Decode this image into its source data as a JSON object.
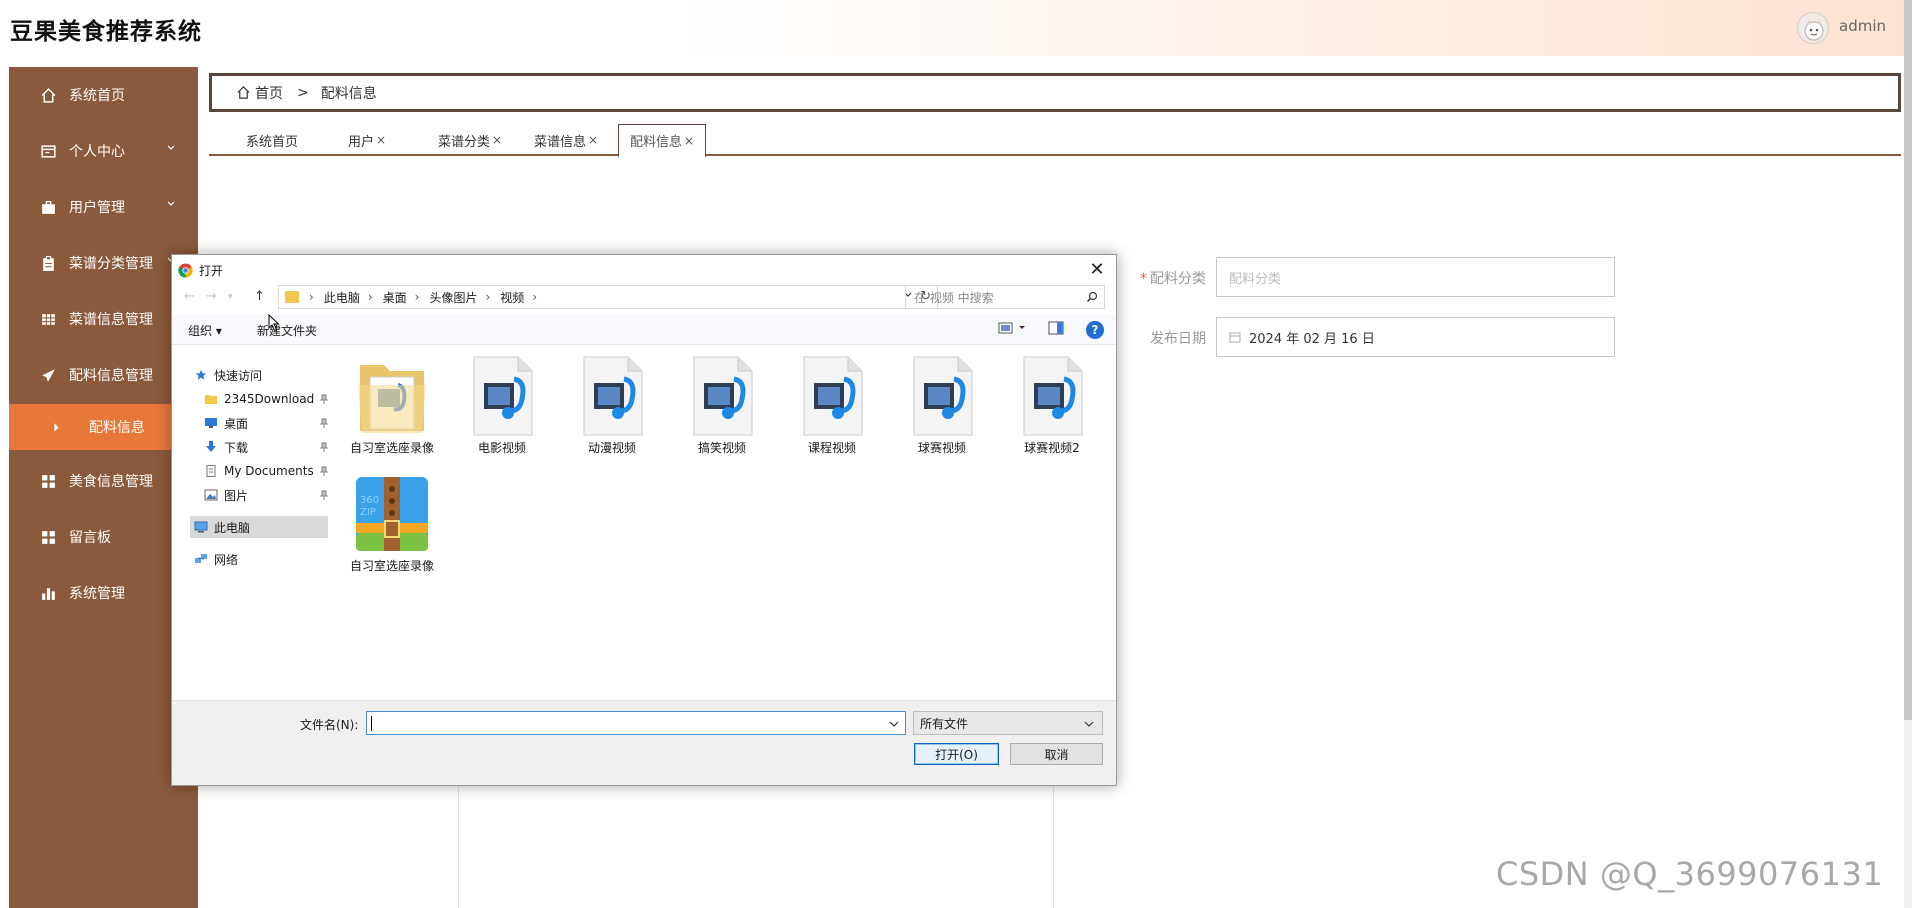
{
  "app": {
    "title": "豆果美食推荐系统",
    "username": "admin"
  },
  "sidebar": {
    "items": [
      {
        "label": "系统首页",
        "icon": "home-icon"
      },
      {
        "label": "个人中心",
        "icon": "card-icon"
      },
      {
        "label": "用户管理",
        "icon": "briefcase-icon"
      },
      {
        "label": "菜谱分类管理",
        "icon": "clipboard-icon"
      },
      {
        "label": "菜谱信息管理",
        "icon": "grid-icon"
      },
      {
        "label": "配料信息管理",
        "icon": "paper-plane-icon"
      },
      {
        "label": "配料信息",
        "icon": "caret-right-icon"
      },
      {
        "label": "美食信息管理",
        "icon": "apps-icon"
      },
      {
        "label": "留言板",
        "icon": "apps-icon"
      },
      {
        "label": "系统管理",
        "icon": "bar-chart-icon"
      }
    ],
    "active_color": "#e8773a",
    "bg_color": "#8b5a3c"
  },
  "breadcrumb": {
    "home": "首页",
    "separator": ">",
    "current": "配料信息"
  },
  "tabs": [
    {
      "label": "系统首页",
      "close": ""
    },
    {
      "label": "用户",
      "close": "×"
    },
    {
      "label": "菜谱分类",
      "close": "×"
    },
    {
      "label": "菜谱信息",
      "close": "×"
    },
    {
      "label": "配料信息",
      "close": "×"
    }
  ],
  "form": {
    "category_label": "配料分类",
    "category_required": "*",
    "category_placeholder": "配料分类",
    "date_label": "发布日期",
    "date_value": "2024 年 02 月 16 日"
  },
  "dialog": {
    "title": "打开",
    "close": "✕",
    "path": [
      "此电脑",
      "桌面",
      "头像图片",
      "视频"
    ],
    "search_placeholder": "在 视频 中搜索",
    "organize": "组织 ▾",
    "new_folder": "新建文件夹",
    "help": "?",
    "nav_pane": [
      {
        "label": "快速访问",
        "icon": "star-icon"
      },
      {
        "label": "2345Download",
        "icon": "folder-icon",
        "pinned": true
      },
      {
        "label": "桌面",
        "icon": "desktop-icon",
        "pinned": true
      },
      {
        "label": "下载",
        "icon": "download-icon",
        "pinned": true
      },
      {
        "label": "My Documents",
        "icon": "document-icon",
        "pinned": true
      },
      {
        "label": "图片",
        "icon": "pictures-icon",
        "pinned": true
      },
      {
        "label": "此电脑",
        "icon": "computer-icon",
        "selected": true
      },
      {
        "label": "网络",
        "icon": "network-icon"
      }
    ],
    "files": [
      {
        "name": "自习室选座录像",
        "type": "folder"
      },
      {
        "name": "电影视频",
        "type": "video"
      },
      {
        "name": "动漫视频",
        "type": "video"
      },
      {
        "name": "搞笑视频",
        "type": "video"
      },
      {
        "name": "课程视频",
        "type": "video"
      },
      {
        "name": "球赛视频",
        "type": "video"
      },
      {
        "name": "球赛视频2",
        "type": "video"
      },
      {
        "name": "自习室选座录像",
        "type": "zip"
      }
    ],
    "filename_label": "文件名(N):",
    "filename_value": "",
    "filetype": "所有文件",
    "open_button": "打开(O)",
    "cancel_button": "取消"
  },
  "watermark": "CSDN @Q_3699076131"
}
